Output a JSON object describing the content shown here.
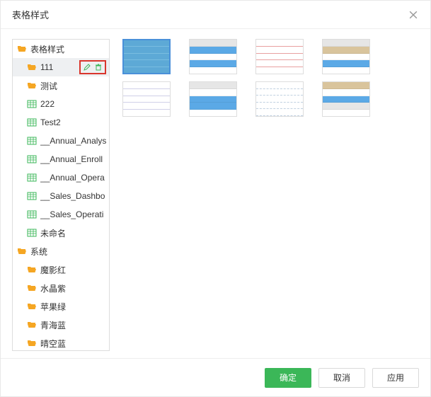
{
  "dialog": {
    "title": "表格样式",
    "close": "×"
  },
  "tree": {
    "root": {
      "label": "表格样式",
      "children": {
        "f1": {
          "label": "111"
        },
        "f2": {
          "label": "测试"
        },
        "t1": {
          "label": "222"
        },
        "t2": {
          "label": "Test2"
        },
        "t3": {
          "label": "__Annual_Analys"
        },
        "t4": {
          "label": "__Annual_Enroll"
        },
        "t5": {
          "label": "__Annual_Opera"
        },
        "t6": {
          "label": "__Sales_Dashbo"
        },
        "t7": {
          "label": "__Sales_Operati"
        },
        "t8": {
          "label": "未命名"
        }
      }
    },
    "system": {
      "label": "系统",
      "children": {
        "s1": {
          "label": "魔影红"
        },
        "s2": {
          "label": "水晶紫"
        },
        "s3": {
          "label": "苹果绿"
        },
        "s4": {
          "label": "青海蓝"
        },
        "s5": {
          "label": "晴空蓝"
        }
      }
    }
  },
  "buttons": {
    "ok": "确定",
    "cancel": "取消",
    "apply": "应用"
  },
  "icons": {
    "folder_color": "#f5a623",
    "table_color": "#3bb758",
    "edit_color": "#3bb758",
    "delete_color": "#3bb758"
  }
}
